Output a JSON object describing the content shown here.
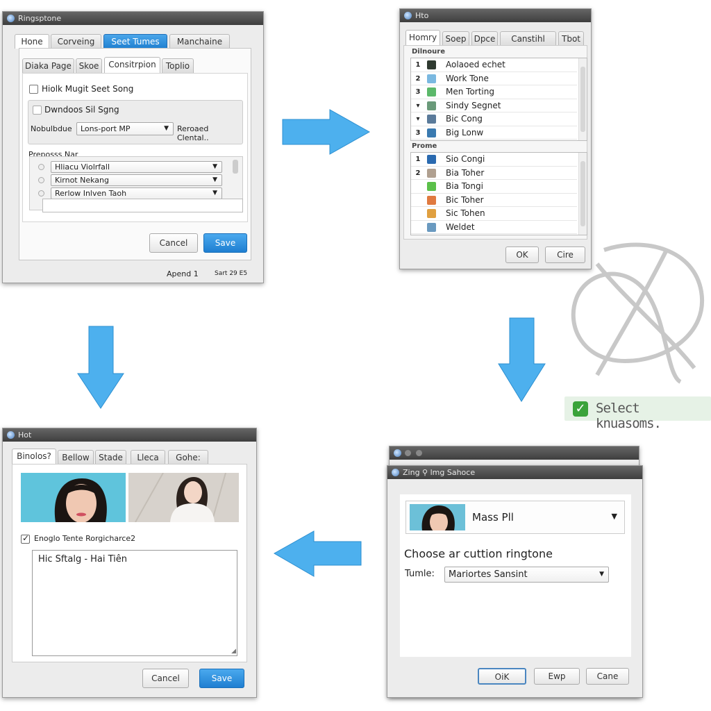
{
  "colors": {
    "arrow": "#4db0ee",
    "primary_button": "#2a8ae0",
    "badge_bg": "#e6f2e6",
    "badge_check": "#3aa33a"
  },
  "window1": {
    "title": "Ringsptone",
    "tabs": [
      "Hone",
      "Corveing",
      "Seet Tumes",
      "Manchaine"
    ],
    "active_tab": "Seet Tumes",
    "subtabs": [
      "Diaka Page",
      "Skoe",
      "Consitrpion",
      "Toplio"
    ],
    "active_subtab": "Consitrpion",
    "checkbox1": {
      "label": "Hiolk Mugit Seet Song",
      "checked": false
    },
    "checkbox2": {
      "label": "Dwndoos Sil Sgng",
      "checked": false
    },
    "format_label": "Nobulbdue",
    "format_value": "Lons-port MP",
    "format_note": "Reroaed Clental..",
    "list_label": "Preposss Nar",
    "list_items": [
      "Hliacu Violrfall",
      "Kirnot Nekang",
      "Rerlow Inlven Taoh"
    ],
    "cancel": "Cancel",
    "save": "Save",
    "status_left": "Apend 1",
    "status_right": "Sart 29 E5"
  },
  "window2": {
    "title": "Hto",
    "tabs": [
      "Homry",
      "Soep",
      "Dpce",
      "Canstihl Loan",
      "Tbot"
    ],
    "active_tab": "Homry",
    "section1_label": "Dilnoure",
    "section1_items": [
      {
        "num": "1",
        "icon": "dark-tile-icon",
        "label": "Aolaoed echet"
      },
      {
        "num": "2",
        "icon": "cloud-icon",
        "label": "Work Tone"
      },
      {
        "num": "3",
        "icon": "bell-icon",
        "label": "Men Torting"
      },
      {
        "num": "▾",
        "icon": "phone-icon",
        "label": "Sindy Segnet"
      },
      {
        "num": "▾",
        "icon": "gallery-icon",
        "label": "Bic Cong"
      },
      {
        "num": "3",
        "icon": "picture-icon",
        "label": "Big Lonw"
      }
    ],
    "section2_label": "Prome",
    "section2_items": [
      {
        "num": "1",
        "icon": "landscape-icon",
        "label": "Sio Congi"
      },
      {
        "num": "2",
        "icon": "gear-icon",
        "label": "Bia Toher"
      },
      {
        "num": "",
        "icon": "green-dot-icon",
        "label": "Bia Tongi"
      },
      {
        "num": "",
        "icon": "orange-circle-icon",
        "label": "Bic Toher"
      },
      {
        "num": "",
        "icon": "flame-icon",
        "label": "Sic Tohen"
      },
      {
        "num": "",
        "icon": "widget-icon",
        "label": "Weldet"
      }
    ],
    "ok": "OK",
    "cancel": "Cire"
  },
  "badge": {
    "icon": "checkmark-icon",
    "text": "Select knuasoms."
  },
  "window3": {
    "title": "Hot",
    "tabs": [
      "Binolos?",
      "Bellow",
      "Stade",
      "Lleca",
      "Gohe:"
    ],
    "active_tab": "Binolos?",
    "checkbox": {
      "label": "Enoglo Tente Rorgicharce2",
      "checked": true
    },
    "text_value": "Hic Sftalg - Hai Tiên",
    "cancel": "Cancel",
    "save": "Save"
  },
  "window4": {
    "title": "Zing ⚲ lmg Sahoce",
    "contact_name": "Mass Pll",
    "heading": "Choose ar cuttion ringtone",
    "tone_label": "Tumle:",
    "tone_value": "Mariortes Sansint",
    "ok": "OiK",
    "exp": "Ewp",
    "cancel": "Cane"
  }
}
